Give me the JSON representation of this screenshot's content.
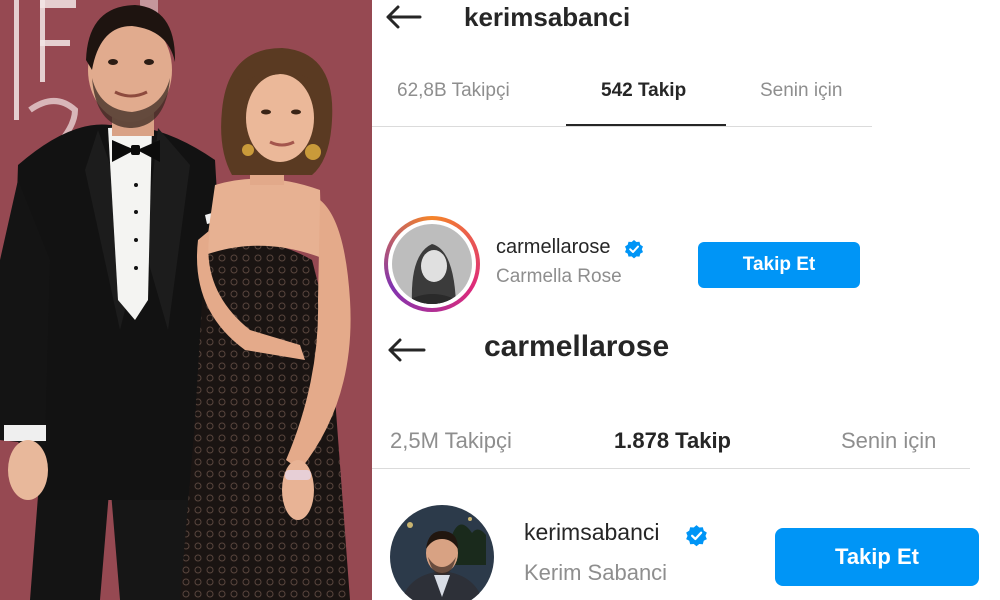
{
  "top_profile": {
    "username": "kerimsabanci",
    "tabs": [
      {
        "label": "62,8B Takipçi",
        "active": false
      },
      {
        "label": "542 Takip",
        "active": true
      },
      {
        "label": "Senin için",
        "active": false
      }
    ],
    "account": {
      "username": "carmellarose",
      "full_name": "Carmella Rose",
      "verified": true,
      "follow_label": "Takip Et"
    }
  },
  "bottom_profile": {
    "username": "carmellarose",
    "tabs": [
      {
        "label": "2,5M Takipçi",
        "active": false
      },
      {
        "label": "1.878 Takip",
        "active": true
      },
      {
        "label": "Senin için",
        "active": false
      }
    ],
    "account": {
      "username": "kerimsabanci",
      "full_name": "Kerim Sabanci",
      "verified": true,
      "follow_label": "Takip Et"
    }
  },
  "colors": {
    "follow_button": "#0095f6",
    "verified_badge": "#0095f6",
    "story_ring_start": "#f58529",
    "story_ring_end": "#dd2a7b",
    "photo_background": "#9b5058"
  },
  "icons": [
    "back-arrow-icon",
    "verified-badge-icon"
  ]
}
